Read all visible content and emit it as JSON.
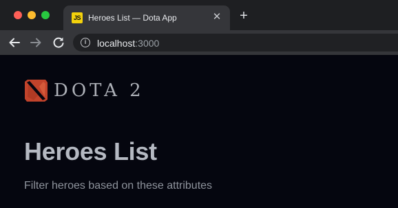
{
  "browser": {
    "tab": {
      "favicon_text": "JS",
      "title": "Heroes List — Dota App",
      "close_glyph": "✕"
    },
    "new_tab_glyph": "+",
    "address": {
      "host": "localhost",
      "port": ":3000"
    },
    "icons": [
      "back-arrow-icon",
      "forward-arrow-icon",
      "reload-icon",
      "info-icon",
      "close-icon",
      "plus-icon"
    ]
  },
  "page": {
    "logo_text": "DOTA 2",
    "title": "Heroes List",
    "subtitle": "Filter heroes based on these attributes"
  },
  "colors": {
    "page_background": "#05060f",
    "logo_red": "#c2432b",
    "title_text": "#b5b9c2"
  }
}
